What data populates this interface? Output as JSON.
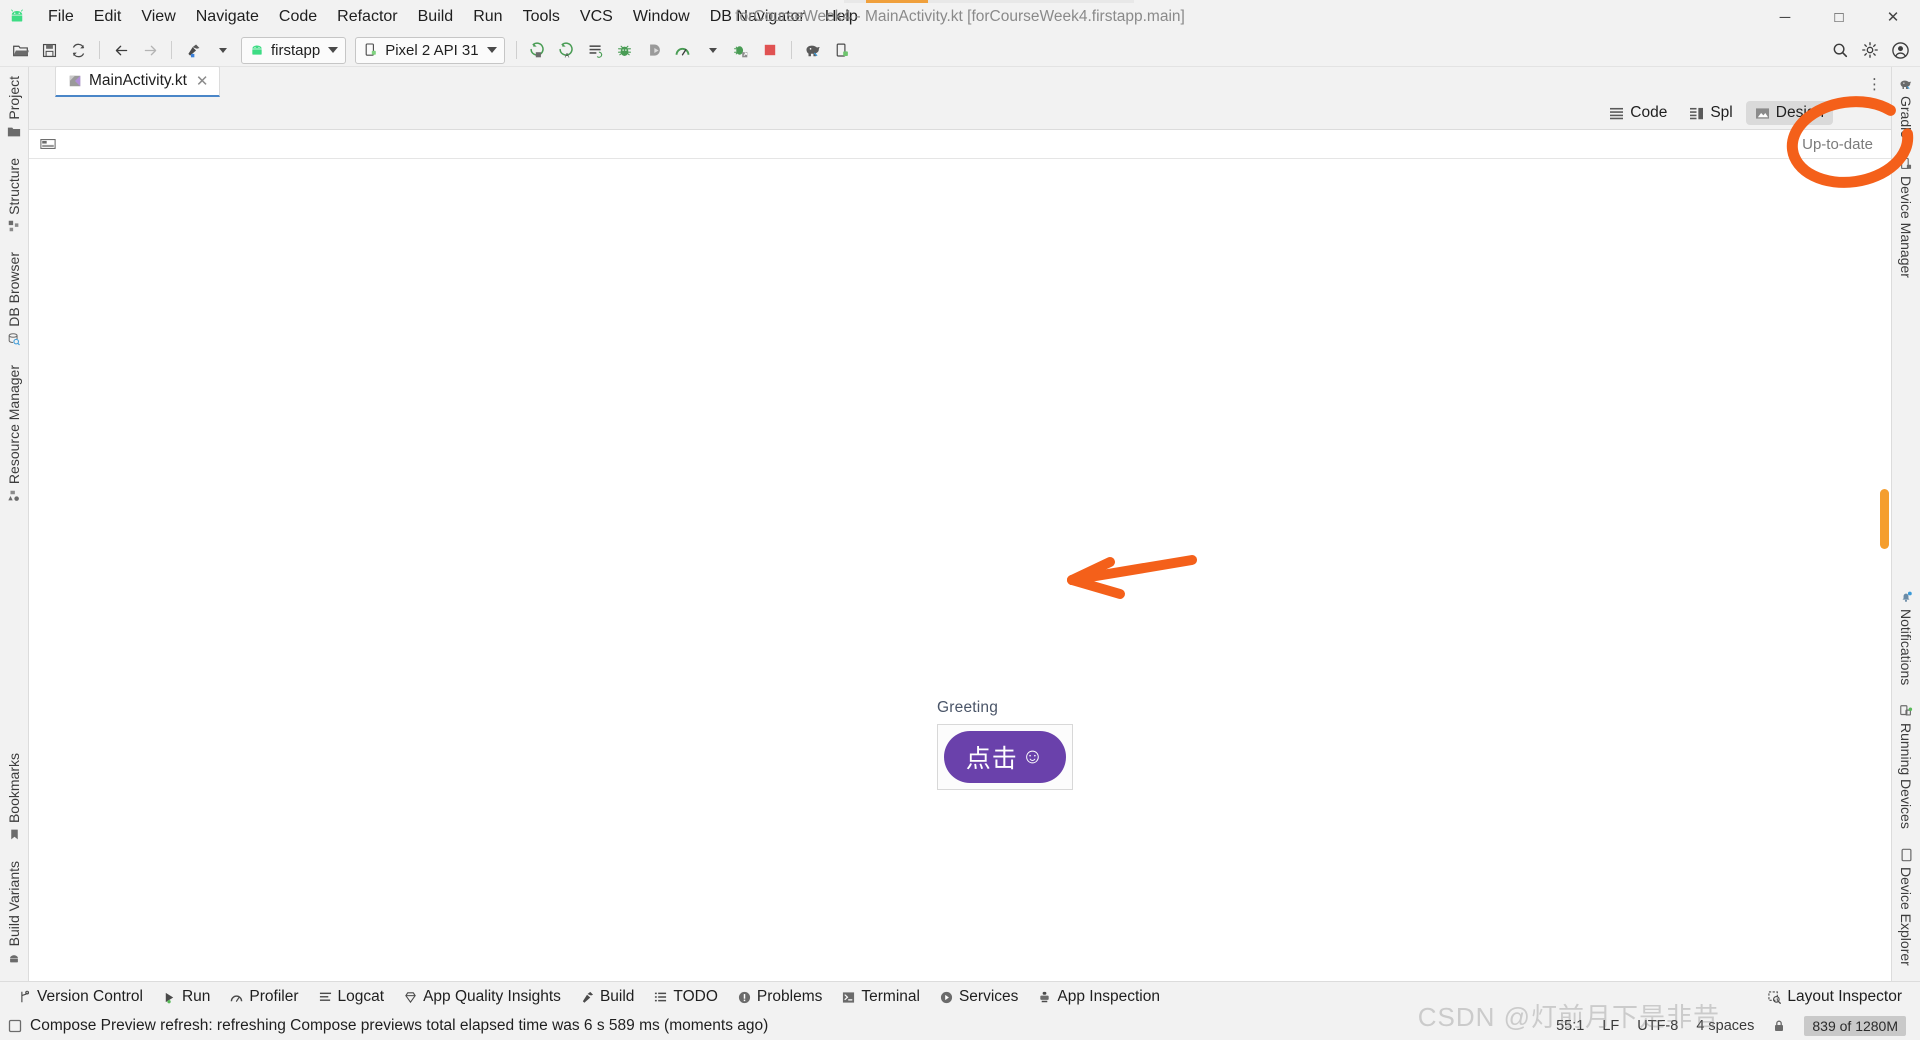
{
  "window": {
    "title": "forCourseWeek4 - MainActivity.kt [forCourseWeek4.firstapp.main]",
    "minimize": "─",
    "maximize": "□",
    "close": "✕"
  },
  "menu": [
    {
      "label": "File"
    },
    {
      "label": "Edit"
    },
    {
      "label": "View"
    },
    {
      "label": "Navigate"
    },
    {
      "label": "Code"
    },
    {
      "label": "Refactor"
    },
    {
      "label": "Build"
    },
    {
      "label": "Run"
    },
    {
      "label": "Tools"
    },
    {
      "label": "VCS"
    },
    {
      "label": "Window"
    },
    {
      "label": "DB Navigator"
    },
    {
      "label": "Help"
    }
  ],
  "toolbar": {
    "open_icon": "folder-open-icon",
    "save_icon": "save-icon",
    "sync_icon": "sync-project-icon",
    "back_icon": "back-arrow-icon",
    "forward_icon": "forward-arrow-icon",
    "build_icon": "build-hammer-icon",
    "module_selector": "firstapp",
    "device_selector": "Pixel 2 API 31",
    "run_icon": "run-icon",
    "run_coverage_icon": "run-with-coverage-icon",
    "apply_changes_icon": "apply-changes-icon",
    "debug_icon": "debug-icon",
    "attach_debugger_icon": "attach-debugger-icon",
    "profiler_icon": "profiler-icon",
    "debug_attach_icon": "debug-attach-process-icon",
    "stop_icon": "stop-icon",
    "gradle_icon": "gradle-elephant-icon",
    "device_manager_icon": "device-manager-icon",
    "search_icon": "search-everywhere-icon",
    "settings_icon": "settings-gear-icon",
    "account_icon": "user-account-icon"
  },
  "editor": {
    "tab": {
      "name": "MainActivity.kt",
      "close": "✕",
      "file_icon": "kotlin-file-icon"
    },
    "kebab": "⋮"
  },
  "mode": {
    "code": "Code",
    "split": "Spl",
    "design": "Design",
    "active": "Design"
  },
  "preview_toolbar": {
    "palette_icon": "design-tools-icon",
    "status": "Up-to-date"
  },
  "preview": {
    "label": "Greeting",
    "button_text": "点击",
    "button_emoji": "☺",
    "button_color": "#6a41ab"
  },
  "annotations": {
    "color": "#f4601a",
    "circle": "circle-around-design-button",
    "arrow": "arrow-pointing-to-preview-button"
  },
  "left_rail": {
    "top": [
      {
        "label": "Project",
        "icon": "project-folder-icon"
      },
      {
        "label": "Structure",
        "icon": "structure-icon"
      },
      {
        "label": "DB Browser",
        "icon": "db-browser-icon"
      },
      {
        "label": "Resource Manager",
        "icon": "resource-manager-icon"
      }
    ],
    "bottom": [
      {
        "label": "Bookmarks",
        "icon": "bookmark-icon"
      },
      {
        "label": "Build Variants",
        "icon": "build-variants-icon"
      }
    ]
  },
  "right_rail": {
    "top": [
      {
        "label": "Gradle",
        "icon": "gradle-elephant-icon"
      },
      {
        "label": "Device Manager",
        "icon": "device-manager-icon"
      }
    ],
    "bottom": [
      {
        "label": "Notifications",
        "icon": "notifications-bell-icon"
      },
      {
        "label": "Running Devices",
        "icon": "running-devices-icon"
      },
      {
        "label": "Device Explorer",
        "icon": "device-explorer-icon"
      }
    ]
  },
  "bottom_bar": {
    "items": [
      {
        "label": "Version Control",
        "icon": "branch-icon"
      },
      {
        "label": "Run",
        "icon": "run-icon"
      },
      {
        "label": "Profiler",
        "icon": "profiler-icon"
      },
      {
        "label": "Logcat",
        "icon": "logcat-icon"
      },
      {
        "label": "App Quality Insights",
        "icon": "app-quality-insights-icon"
      },
      {
        "label": "Build",
        "icon": "build-hammer-icon"
      },
      {
        "label": "TODO",
        "icon": "todo-list-icon"
      },
      {
        "label": "Problems",
        "icon": "problems-icon"
      },
      {
        "label": "Terminal",
        "icon": "terminal-icon"
      },
      {
        "label": "Services",
        "icon": "services-icon"
      },
      {
        "label": "App Inspection",
        "icon": "app-inspection-icon"
      }
    ],
    "right": {
      "label": "Layout Inspector",
      "icon": "layout-inspector-icon"
    }
  },
  "status_bar": {
    "message": "Compose Preview refresh: refreshing Compose previews total elapsed time was 6 s 589 ms (moments ago)",
    "message_icon": "event-log-icon",
    "caret": "55:1",
    "line_separator": "LF",
    "encoding": "UTF-8",
    "indent": "4 spaces",
    "lock_icon": "read-only-lock-icon",
    "memory": "839 of 1280M"
  },
  "watermark": "CSDN @灯前月下是非昔"
}
